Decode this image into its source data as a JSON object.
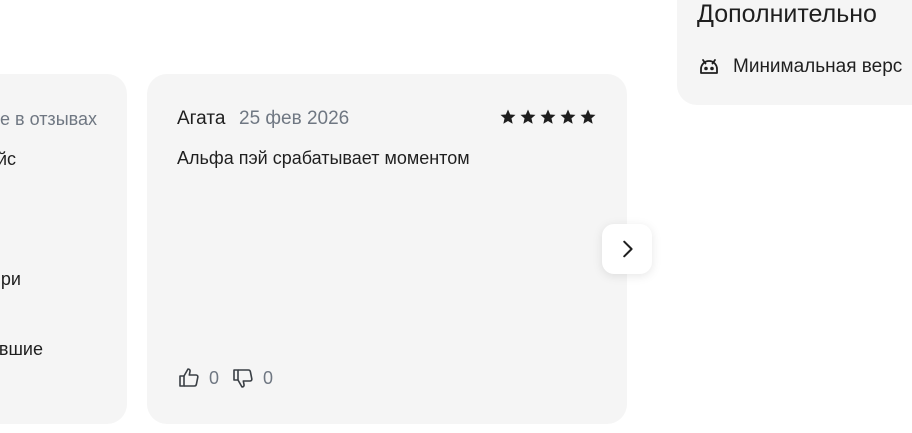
{
  "left_card": {
    "note": "е в отзывах",
    "fragment_1": "йс",
    "fragment_2": "ри",
    "fragment_3": "вшие"
  },
  "review": {
    "author": "Агата",
    "date": "25 фев 2026",
    "rating": 5,
    "text": "Альфа пэй срабатывает моментом",
    "likes": "0",
    "dislikes": "0"
  },
  "extra": {
    "title": "Дополнительно",
    "min_version_label": "Минимальная верс",
    "min_version_icon": "android-icon"
  },
  "colors": {
    "card_bg": "#f5f5f5",
    "text": "#1f1f1f",
    "muted": "#6f7782"
  }
}
